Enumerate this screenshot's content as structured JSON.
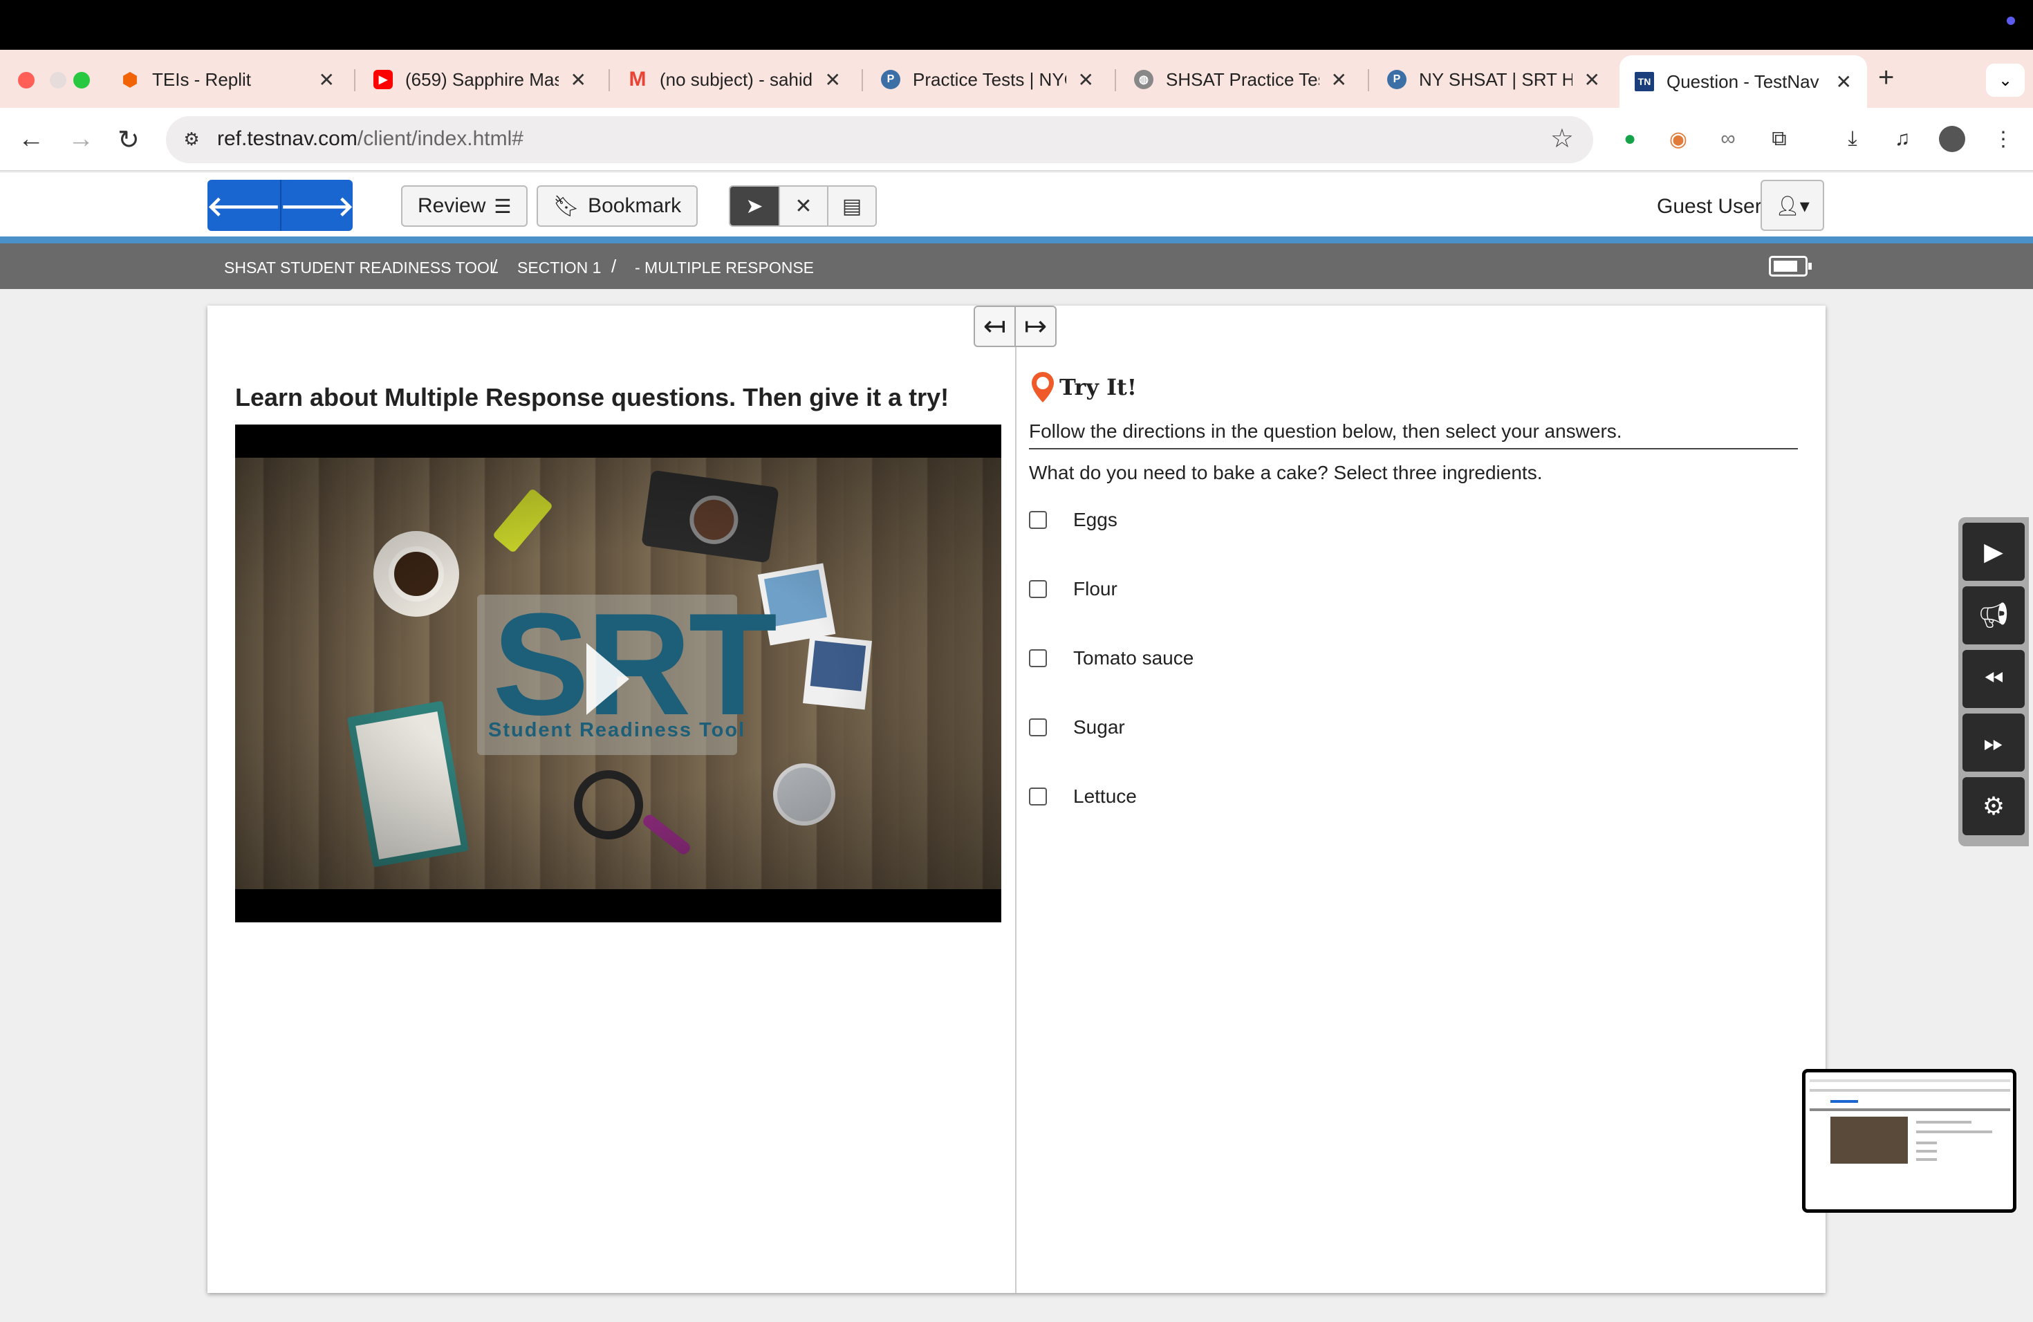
{
  "browser": {
    "tabs": [
      {
        "title": "TEIs - Replit",
        "icon": "replit-icon",
        "color": "#f26207"
      },
      {
        "title": "(659) Sapphire Mas",
        "icon": "youtube-icon",
        "color": "#ff0000"
      },
      {
        "title": "(no subject) - sahid",
        "icon": "gmail-icon",
        "color": "#ea4335"
      },
      {
        "title": "Practice Tests | NYC",
        "icon": "p-logo-icon",
        "color": "#3b6fa6"
      },
      {
        "title": "SHSAT Practice Tes",
        "icon": "globe-icon",
        "color": "#888888"
      },
      {
        "title": "NY SHSAT | SRT Ho",
        "icon": "p-logo-icon",
        "color": "#3b6fa6"
      },
      {
        "title": "Question - TestNav",
        "icon": "testnav-icon",
        "color": "#1a3d7c"
      }
    ],
    "new_tab": "+",
    "url_host": "ref.testnav.com",
    "url_path": "/client/index.html#"
  },
  "toolbar": {
    "back_label": "🡐",
    "next_label": "🡒",
    "review_label": "Review",
    "bookmark_label": "Bookmark",
    "user_label": "Guest User"
  },
  "breadcrumb": {
    "items": [
      "SHSAT STUDENT READINESS TOOL",
      "SECTION 1",
      "- MULTIPLE RESPONSE"
    ],
    "separator": "/"
  },
  "left_panel": {
    "heading": "Learn about Multiple Response questions. Then give it a try!",
    "video": {
      "logo": "SRT",
      "logo_sub": "Student Readiness Tool"
    }
  },
  "right_panel": {
    "try_it": "Try It!",
    "directions": "Follow the directions in the question below, then select your answers.",
    "question": "What do you need to bake a cake? Select three ingredients.",
    "options": [
      "Eggs",
      "Flour",
      "Tomato sauce",
      "Sugar",
      "Lettuce"
    ]
  },
  "side_tools": [
    "play-icon",
    "megaphone-icon",
    "rewind-icon",
    "fast-forward-icon",
    "settings-icon"
  ]
}
